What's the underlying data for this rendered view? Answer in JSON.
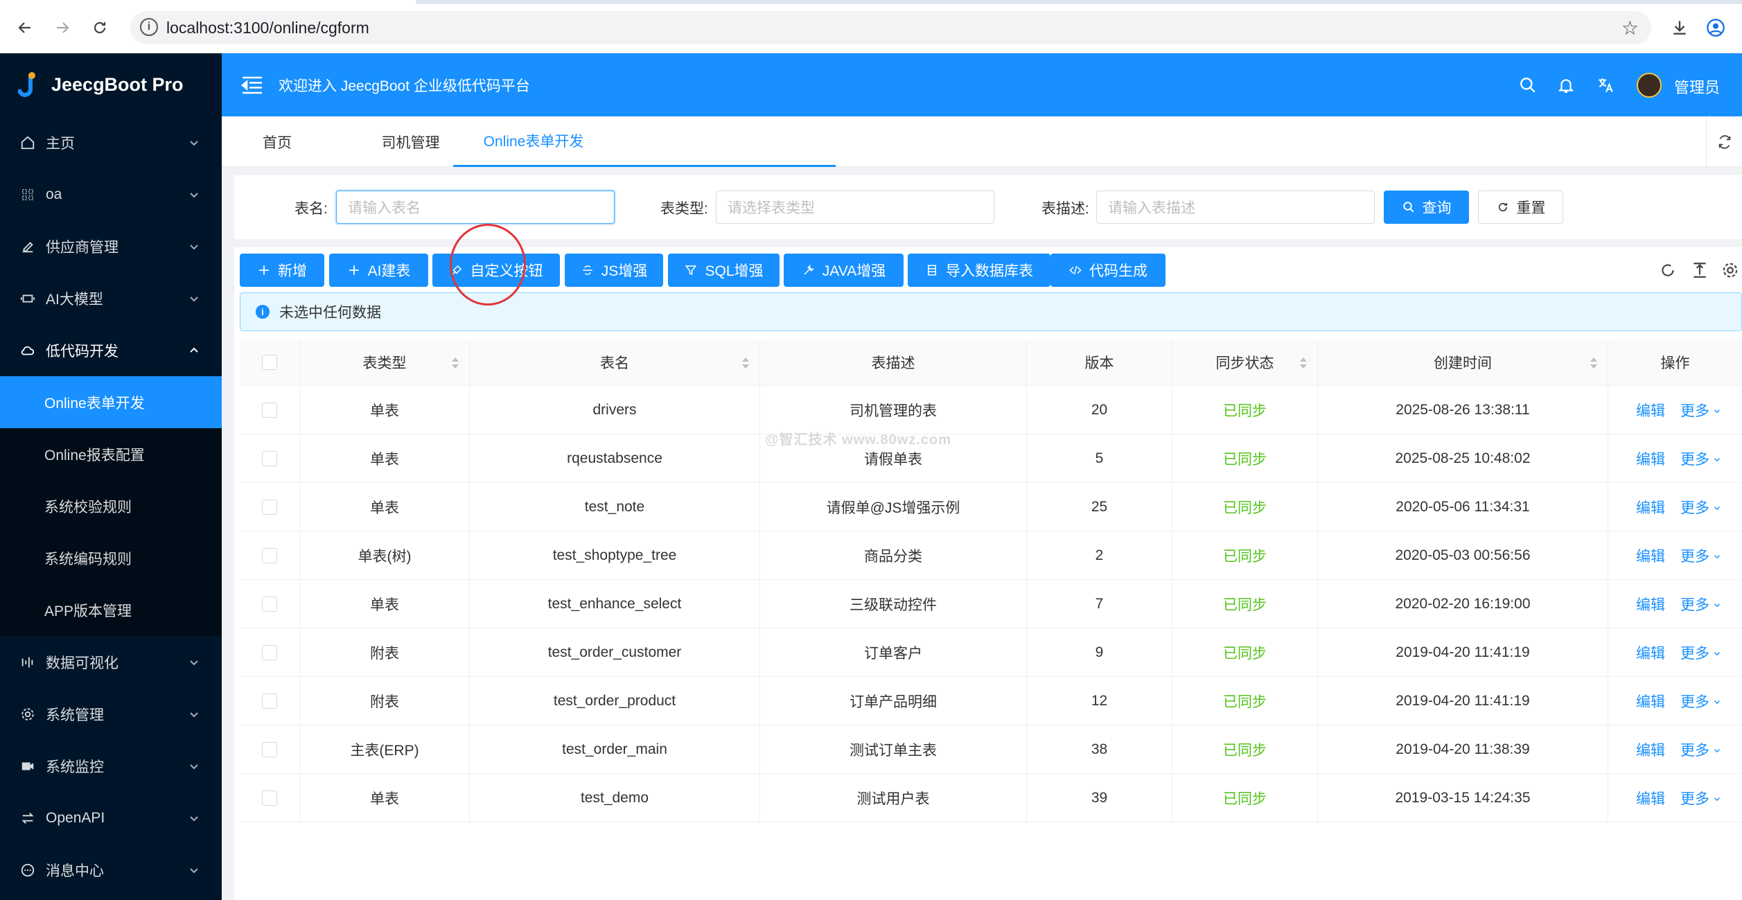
{
  "browser": {
    "url": "localhost:3100/online/cgform"
  },
  "app": {
    "title": "JeecgBoot Pro",
    "welcome": "欢迎进入 JeecgBoot 企业级低代码平台",
    "user": "管理员"
  },
  "sidebar": {
    "items": [
      {
        "label": "主页",
        "icon": "home-icon"
      },
      {
        "label": "oa",
        "icon": "grid-icon"
      },
      {
        "label": "供应商管理",
        "icon": "edit-icon"
      },
      {
        "label": "AI大模型",
        "icon": "robot-icon"
      },
      {
        "label": "低代码开发",
        "icon": "cloud-icon"
      },
      {
        "label": "数据可视化",
        "icon": "chart-icon"
      },
      {
        "label": "系统管理",
        "icon": "gear-icon"
      },
      {
        "label": "系统监控",
        "icon": "video-icon"
      },
      {
        "label": "OpenAPI",
        "icon": "swap-icon"
      },
      {
        "label": "消息中心",
        "icon": "message-icon"
      }
    ],
    "sub_items": [
      {
        "label": "Online表单开发"
      },
      {
        "label": "Online报表配置"
      },
      {
        "label": "系统校验规则"
      },
      {
        "label": "系统编码规则"
      },
      {
        "label": "APP版本管理"
      }
    ]
  },
  "tabs": [
    {
      "label": "首页"
    },
    {
      "label": "司机管理"
    },
    {
      "label": "Online表单开发"
    }
  ],
  "search": {
    "name_label": "表名:",
    "name_placeholder": "请输入表名",
    "type_label": "表类型:",
    "type_placeholder": "请选择表类型",
    "desc_label": "表描述:",
    "desc_placeholder": "请输入表描述",
    "query_label": "查询",
    "reset_label": "重置"
  },
  "toolbar": {
    "buttons": [
      {
        "label": "新增"
      },
      {
        "label": "AI建表"
      },
      {
        "label": "自定义按钮"
      },
      {
        "label": "JS增强"
      },
      {
        "label": "SQL增强"
      },
      {
        "label": "JAVA增强"
      },
      {
        "label": "导入数据库表"
      },
      {
        "label": "代码生成"
      }
    ]
  },
  "alert": {
    "text": "未选中任何数据"
  },
  "table": {
    "columns": [
      "表类型",
      "表名",
      "表描述",
      "版本",
      "同步状态",
      "创建时间",
      "操作"
    ],
    "edit_label": "编辑",
    "more_label": "更多",
    "rows": [
      {
        "type": "单表",
        "name": "drivers",
        "desc": "司机管理的表",
        "version": "20",
        "status": "已同步",
        "created": "2025-08-26 13:38:11"
      },
      {
        "type": "单表",
        "name": "rqeustabsence",
        "desc": "请假单表",
        "version": "5",
        "status": "已同步",
        "created": "2025-08-25 10:48:02"
      },
      {
        "type": "单表",
        "name": "test_note",
        "desc": "请假单@JS增强示例",
        "version": "25",
        "status": "已同步",
        "created": "2020-05-06 11:34:31"
      },
      {
        "type": "单表(树)",
        "name": "test_shoptype_tree",
        "desc": "商品分类",
        "version": "2",
        "status": "已同步",
        "created": "2020-05-03 00:56:56"
      },
      {
        "type": "单表",
        "name": "test_enhance_select",
        "desc": "三级联动控件",
        "version": "7",
        "status": "已同步",
        "created": "2020-02-20 16:19:00"
      },
      {
        "type": "附表",
        "name": "test_order_customer",
        "desc": "订单客户",
        "version": "9",
        "status": "已同步",
        "created": "2019-04-20 11:41:19"
      },
      {
        "type": "附表",
        "name": "test_order_product",
        "desc": "订单产品明细",
        "version": "12",
        "status": "已同步",
        "created": "2019-04-20 11:41:19"
      },
      {
        "type": "主表(ERP)",
        "name": "test_order_main",
        "desc": "测试订单主表",
        "version": "38",
        "status": "已同步",
        "created": "2019-04-20 11:38:39"
      },
      {
        "type": "单表",
        "name": "test_demo",
        "desc": "测试用户表",
        "version": "39",
        "status": "已同步",
        "created": "2019-03-15 14:24:35"
      }
    ]
  },
  "watermark": "@智汇技术 www.80wz.com",
  "colors": {
    "primary": "#1890ff",
    "sidebar": "#001529",
    "success": "#52c41a",
    "annotation": "#e0353b"
  }
}
